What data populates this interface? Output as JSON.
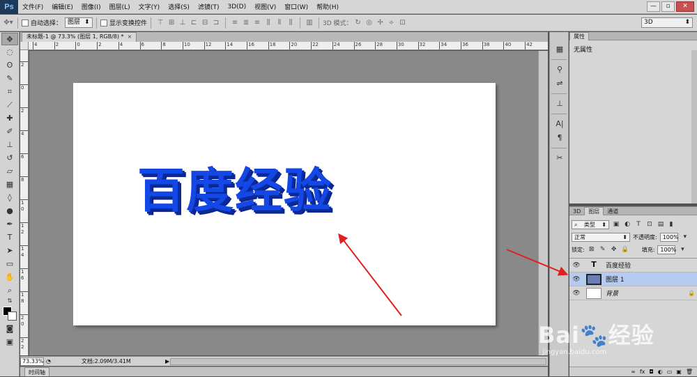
{
  "app": {
    "logo": "Ps"
  },
  "menu": [
    "文件(F)",
    "编辑(E)",
    "图像(I)",
    "图层(L)",
    "文字(Y)",
    "选择(S)",
    "滤镜(T)",
    "3D(D)",
    "视图(V)",
    "窗口(W)",
    "帮助(H)"
  ],
  "window_controls": {
    "minimize": "—",
    "restore": "▫",
    "close": "✕"
  },
  "options_bar": {
    "auto_select_label": "自动选择：",
    "auto_select_value": "图层",
    "show_transform_label": "显示变换控件",
    "mode_3d_label": "3D 模式：",
    "workspace_select": "3D"
  },
  "document": {
    "tab_title": "未标题-1 @ 73.3% (图层 1, RGB/8) *",
    "close_glyph": "×",
    "canvas_text": "百度经验"
  },
  "ruler": {
    "h_labels": [
      "4",
      "2",
      "0",
      "2",
      "4",
      "6",
      "8",
      "10",
      "12",
      "14",
      "16",
      "18",
      "20",
      "22",
      "24",
      "26",
      "28",
      "30",
      "32",
      "34",
      "36",
      "38",
      "40",
      "42"
    ],
    "v_labels": [
      "2",
      "0",
      "2",
      "4",
      "6",
      "8",
      "1 0",
      "1 2",
      "1 4",
      "1 6",
      "1 8",
      "2 0",
      "2 2"
    ]
  },
  "status_bar": {
    "zoom": "73.33%",
    "doc_info": "文档:2.09M/3.41M"
  },
  "timeline": {
    "label": "时间轴"
  },
  "properties_panel": {
    "tab": "属性",
    "content": "无属性"
  },
  "layers_panel": {
    "tabs": [
      "3D",
      "图层",
      "通道"
    ],
    "filter_kind": "类型",
    "blend_mode": "正常",
    "opacity_label": "不透明度:",
    "opacity_value": "100%",
    "lock_label": "锁定:",
    "fill_label": "填充:",
    "fill_value": "100%",
    "layers": [
      {
        "name": "百度经验",
        "kind": "type",
        "thumb": "T",
        "selected": false,
        "locked": false
      },
      {
        "name": "图层 1",
        "kind": "image",
        "thumb": "",
        "selected": true,
        "locked": false
      },
      {
        "name": "背景",
        "kind": "background",
        "thumb": "",
        "selected": false,
        "locked": true
      }
    ],
    "footer_icons": [
      "∞",
      "fx",
      "◘",
      "◐",
      "▭",
      "▣",
      "🗑"
    ]
  },
  "watermark": {
    "brand": "Bai🐾经验",
    "url": "jingyan.baidu.com"
  },
  "colors": {
    "accent_text": "#1448e6",
    "arrow": "#e02020",
    "selected_layer": "#b5cbef"
  }
}
